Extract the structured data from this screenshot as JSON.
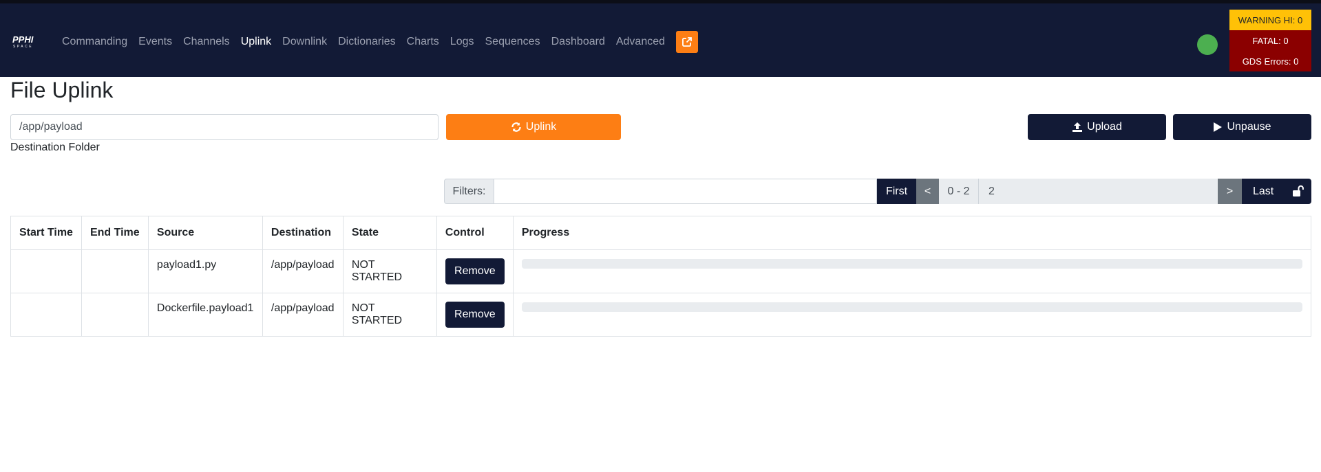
{
  "nav": {
    "logo_text": "PPHI SPACE",
    "items": [
      {
        "label": "Commanding",
        "active": false
      },
      {
        "label": "Events",
        "active": false
      },
      {
        "label": "Channels",
        "active": false
      },
      {
        "label": "Uplink",
        "active": true
      },
      {
        "label": "Downlink",
        "active": false
      },
      {
        "label": "Dictionaries",
        "active": false
      },
      {
        "label": "Charts",
        "active": false
      },
      {
        "label": "Logs",
        "active": false
      },
      {
        "label": "Sequences",
        "active": false
      },
      {
        "label": "Dashboard",
        "active": false
      },
      {
        "label": "Advanced",
        "active": false
      }
    ],
    "external_link_icon": "external-link-icon",
    "status_color": "#4caf50",
    "alerts": {
      "warning": "WARNING HI: 0",
      "fatal": "FATAL: 0",
      "gds_errors": "GDS Errors: 0"
    }
  },
  "page": {
    "title": "File Uplink",
    "destination": {
      "value": "/app/payload",
      "label": "Destination Folder"
    },
    "buttons": {
      "uplink": "Uplink",
      "upload": "Upload",
      "unpause": "Unpause"
    },
    "filter": {
      "label": "Filters:",
      "value": ""
    },
    "pagination": {
      "first": "First",
      "prev": "<",
      "range": "0 - 2",
      "count": "2",
      "next": ">",
      "last": "Last"
    }
  },
  "table": {
    "headers": [
      "Start Time",
      "End Time",
      "Source",
      "Destination",
      "State",
      "Control",
      "Progress"
    ],
    "rows": [
      {
        "start_time": "",
        "end_time": "",
        "source": "payload1.py",
        "destination": "/app/payload",
        "state": "NOT STARTED",
        "control": "Remove",
        "progress": 0
      },
      {
        "start_time": "",
        "end_time": "",
        "source": "Dockerfile.payload1",
        "destination": "/app/payload",
        "state": "NOT STARTED",
        "control": "Remove",
        "progress": 0
      }
    ]
  },
  "colors": {
    "navbar": "#121a36",
    "accent": "#fd7e14",
    "warning": "#ffc107",
    "danger": "#8b0000"
  }
}
